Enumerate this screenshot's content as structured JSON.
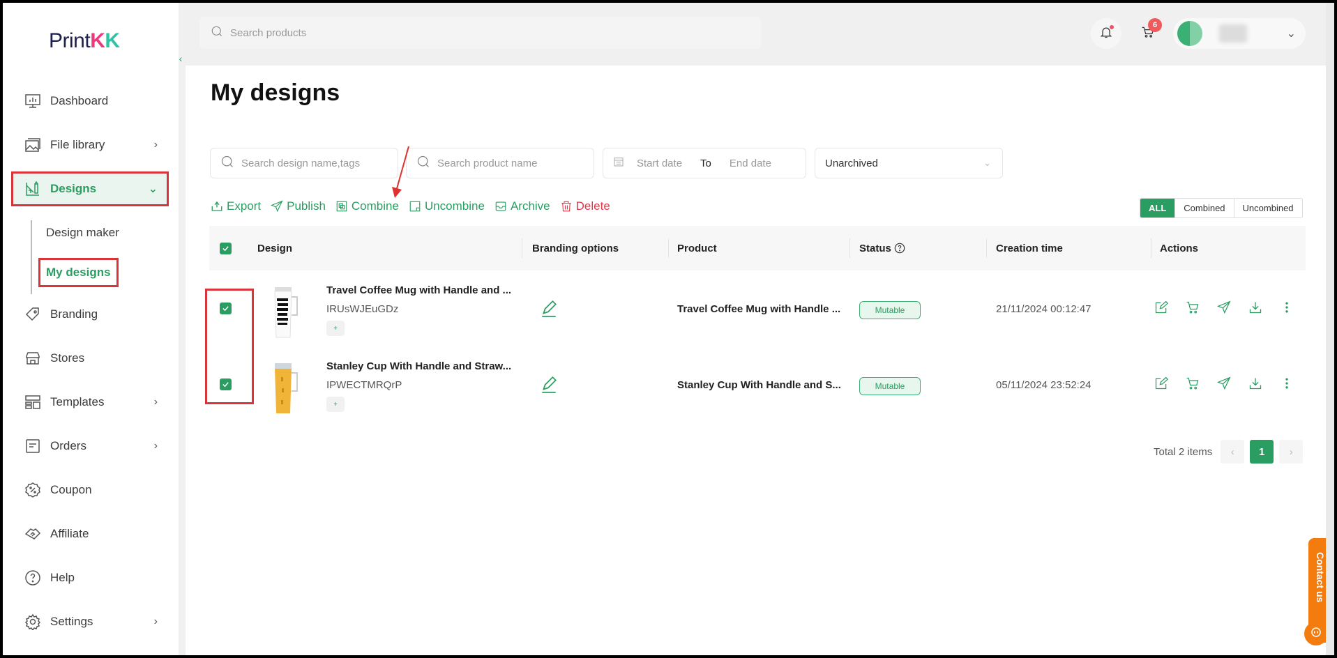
{
  "brand": {
    "name_a": "Print",
    "name_k1": "K",
    "name_k2": "K"
  },
  "topbar": {
    "search_placeholder": "Search products",
    "cart_count": "6"
  },
  "sidebar": {
    "items": [
      {
        "label": "Dashboard",
        "icon": "dashboard-icon"
      },
      {
        "label": "File library",
        "icon": "image-library-icon"
      },
      {
        "label": "Designs",
        "icon": "designs-icon"
      },
      {
        "label": "Branding",
        "icon": "tag-icon"
      },
      {
        "label": "Stores",
        "icon": "store-icon"
      },
      {
        "label": "Templates",
        "icon": "templates-icon"
      },
      {
        "label": "Orders",
        "icon": "orders-icon"
      },
      {
        "label": "Coupon",
        "icon": "coupon-icon"
      },
      {
        "label": "Affiliate",
        "icon": "handshake-icon"
      },
      {
        "label": "Help",
        "icon": "help-icon"
      },
      {
        "label": "Settings",
        "icon": "gear-icon"
      }
    ],
    "subitems": [
      {
        "label": "Design maker"
      },
      {
        "label": "My designs"
      }
    ]
  },
  "page": {
    "title": "My designs"
  },
  "filters": {
    "design_search_placeholder": "Search design name,tags",
    "product_search_placeholder": "Search product name",
    "start_date_placeholder": "Start date",
    "to_label": "To",
    "end_date_placeholder": "End date",
    "archive_select_value": "Unarchived"
  },
  "bulk_actions": {
    "export": "Export",
    "publish": "Publish",
    "combine": "Combine",
    "uncombine": "Uncombine",
    "archive": "Archive",
    "delete": "Delete"
  },
  "view_toggle": {
    "all": "ALL",
    "combined": "Combined",
    "uncombined": "Uncombined",
    "selected": "ALL"
  },
  "table": {
    "headers": {
      "design": "Design",
      "branding": "Branding options",
      "product": "Product",
      "status": "Status",
      "creation_time": "Creation time",
      "actions": "Actions"
    },
    "rows": [
      {
        "checked": true,
        "design_name": "Travel Coffee Mug with Handle and ...",
        "design_code": "IRUsWJEuGDz",
        "tag_add": "+",
        "product": "Travel Coffee Mug with Handle ...",
        "status": "Mutable",
        "creation_time": "21/11/2024 00:12:47"
      },
      {
        "checked": true,
        "design_name": "Stanley Cup With Handle and Straw...",
        "design_code": "IPWECTMRQrP",
        "tag_add": "+",
        "product": "Stanley Cup With Handle and S...",
        "status": "Mutable",
        "creation_time": "05/11/2024 23:52:24"
      }
    ]
  },
  "pagination": {
    "total_label": "Total 2 items",
    "current_page": "1"
  },
  "contact": {
    "label": "Contact us"
  },
  "colors": {
    "accent": "#2a9d62",
    "danger": "#e03a4a",
    "annotation": "#d9343a",
    "contact": "#f47b0e"
  }
}
